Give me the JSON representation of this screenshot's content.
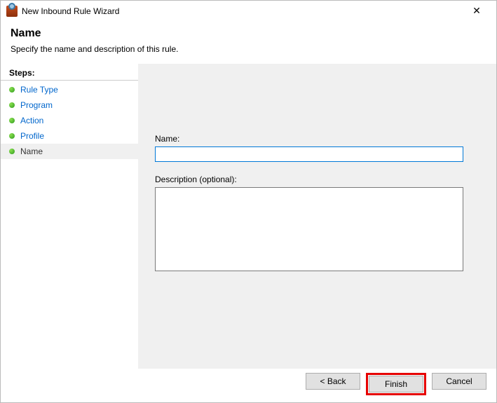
{
  "window": {
    "title": "New Inbound Rule Wizard",
    "close_glyph": "✕"
  },
  "header": {
    "title": "Name",
    "subtitle": "Specify the name and description of this rule."
  },
  "sidebar": {
    "title": "Steps:",
    "items": [
      {
        "label": "Rule Type",
        "current": false
      },
      {
        "label": "Program",
        "current": false
      },
      {
        "label": "Action",
        "current": false
      },
      {
        "label": "Profile",
        "current": false
      },
      {
        "label": "Name",
        "current": true
      }
    ]
  },
  "form": {
    "name_label": "Name:",
    "name_value": "",
    "desc_label": "Description (optional):",
    "desc_value": ""
  },
  "buttons": {
    "back": "< Back",
    "finish": "Finish",
    "cancel": "Cancel"
  }
}
